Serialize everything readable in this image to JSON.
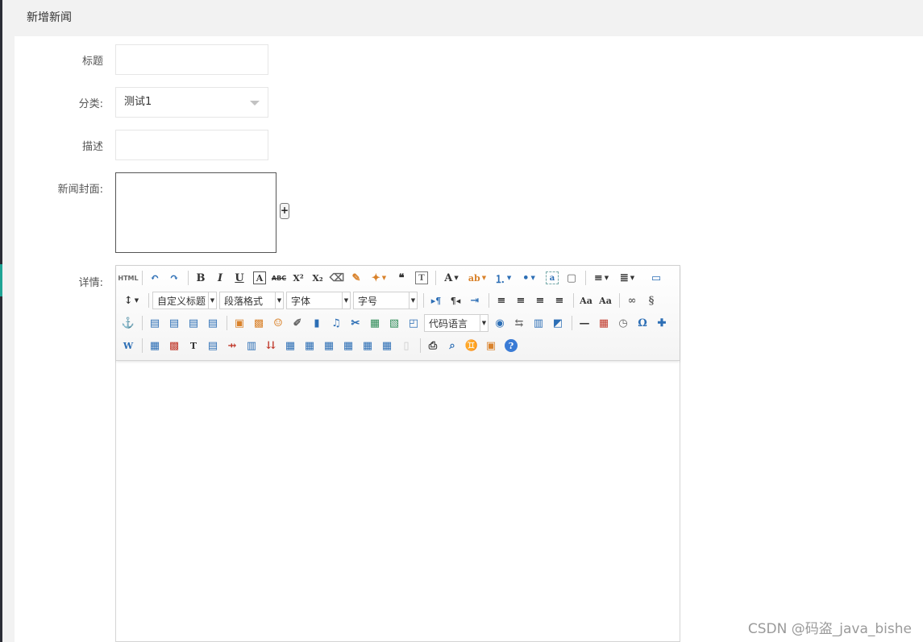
{
  "page": {
    "title": "新增新闻"
  },
  "form": {
    "title_label": "标题",
    "title_value": "",
    "category_label": "分类:",
    "category_selected": "测试1",
    "desc_label": "描述",
    "desc_value": "",
    "cover_label": "新闻封面:",
    "cover_add": "+",
    "detail_label": "详情:"
  },
  "editor": {
    "combos": {
      "heading": "自定义标题",
      "paragraph": "段落格式",
      "font": "字体",
      "size": "字号",
      "code": "代码语言"
    },
    "icon_glyphs": {
      "html": "HTML",
      "undo": "↶",
      "redo": "↷",
      "bold": "B",
      "italic": "I",
      "underline": "U",
      "border": "A",
      "strike": "ABC",
      "sup": "X²",
      "sub": "X₂",
      "eraser": "⌫",
      "brush": "✎",
      "magic": "✦",
      "quote": "❝",
      "paste": "T",
      "fontcolor": "A",
      "bgcolor": "ab",
      "ol": "⒈",
      "ul": "•",
      "select": "a",
      "page": "▢",
      "rowspace": "≡",
      "indent": "≣",
      "preview": "▭",
      "linespace": "↕",
      "ltr": "▸¶",
      "rtl": "¶◂",
      "indent2": "⇥",
      "left": "≡",
      "center": "≡",
      "right": "≡",
      "justify": "≡",
      "upper": "Aa",
      "lower": "Aa",
      "link": "∞",
      "unlink": "§",
      "anchor": "⚓",
      "imgnone": "▤",
      "imgleft": "▤",
      "imgright": "▤",
      "imgcenter": "▤",
      "image": "▣",
      "multiimg": "▩",
      "emotion": "☺",
      "scrawl": "✐",
      "video": "▮",
      "music": "♫",
      "attach": "✂",
      "map": "▦",
      "gmap": "▧",
      "frame": "◰",
      "insertcode": "◉",
      "pagebreak": "⇆",
      "template": "▥",
      "bgimg": "◩",
      "hr": "—",
      "date": "▦",
      "time": "◷",
      "special": "Ω",
      "snap": "✚",
      "word": "W",
      "table": "▦",
      "deltable": "▩",
      "caption": "T",
      "row": "▤",
      "delrow": "⇸",
      "col": "▥",
      "delcol": "⇊",
      "merge": "▦",
      "mergeright": "▦",
      "mergedown": "▦",
      "split": "▦",
      "splitrow": "▦",
      "splitcol": "▦",
      "chart": "▯",
      "print": "⎙",
      "search": "⌕",
      "replace": "♊",
      "drafts": "▣",
      "help": "?"
    }
  },
  "watermark": "CSDN @码盗_java_bishe"
}
